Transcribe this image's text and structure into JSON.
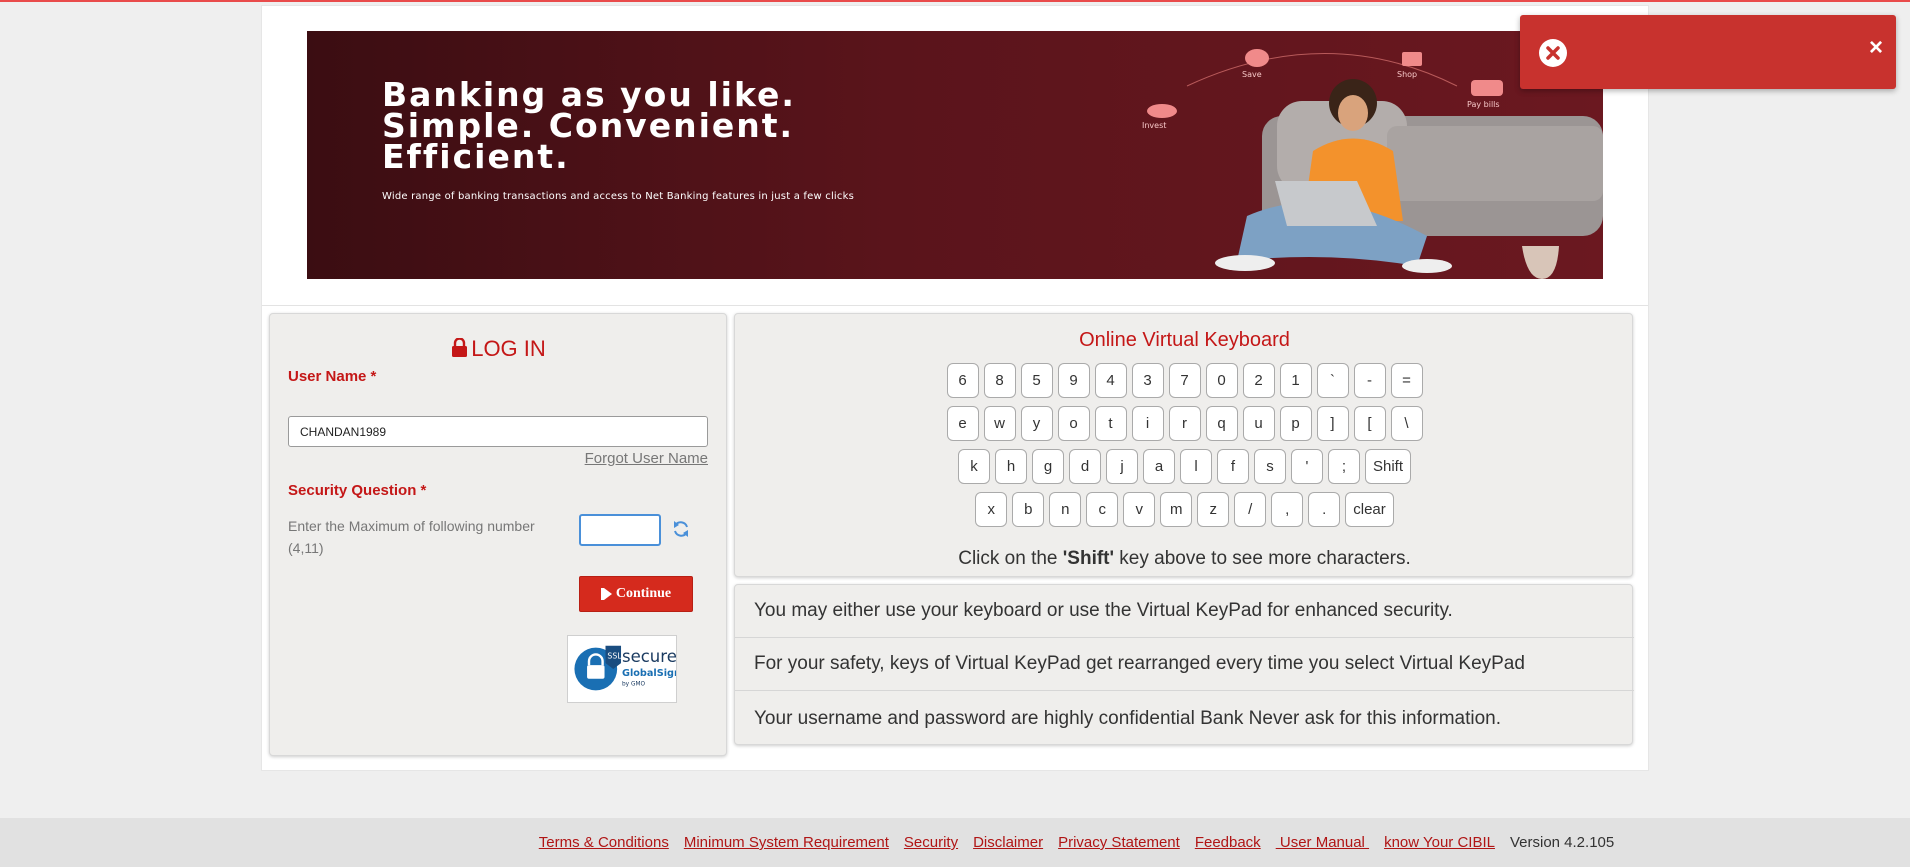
{
  "banner": {
    "headline": [
      "Banking as you like.",
      "Simple. Convenient.",
      "Efficient."
    ],
    "subtitle": "Wide range of banking transactions and access to Net Banking features in just a few clicks",
    "icons": [
      {
        "name": "invest-icon",
        "label": "Invest"
      },
      {
        "name": "save-icon",
        "label": "Save"
      },
      {
        "name": "shop-icon",
        "label": "Shop"
      },
      {
        "name": "pay-bills-icon",
        "label": "Pay bills"
      }
    ]
  },
  "login": {
    "title": "LOG IN",
    "username_label": "User Name *",
    "username_value": "CHANDAN1989",
    "forgot_username": "Forgot User Name",
    "security_label": "Security Question *",
    "security_question": "Enter the Maximum of following number (4,11)",
    "answer_value": "",
    "continue_label": "Continue",
    "badge": {
      "ssl": "SSL",
      "secure": "secure",
      "brand": "GlobalSign",
      "by": "by GMO"
    }
  },
  "keyboard": {
    "title": "Online Virtual Keyboard",
    "rows": [
      [
        "6",
        "8",
        "5",
        "9",
        "4",
        "3",
        "7",
        "0",
        "2",
        "1",
        "`",
        "-",
        "="
      ],
      [
        "e",
        "w",
        "y",
        "o",
        "t",
        "i",
        "r",
        "q",
        "u",
        "p",
        "]",
        "[",
        "\\"
      ],
      [
        "k",
        "h",
        "g",
        "d",
        "j",
        "a",
        "l",
        "f",
        "s",
        "'",
        ";",
        "Shift"
      ],
      [
        "x",
        "b",
        "n",
        "c",
        "v",
        "m",
        "z",
        "/",
        ",",
        ".",
        "clear"
      ]
    ],
    "note_prefix": "Click on the ",
    "note_key": "'Shift'",
    "note_suffix": " key above to see more characters."
  },
  "info": [
    "You may either use your keyboard or use the Virtual KeyPad for enhanced security.",
    "For your safety, keys of Virtual KeyPad get rearranged every time you select Virtual KeyPad",
    "Your username and password are highly confidential Bank Never ask for this information."
  ],
  "footer": {
    "links": [
      "Terms & Conditions",
      "Minimum System Requirement",
      "Security",
      "Disclaimer",
      "Privacy Statement",
      "Feedback",
      " User Manual ",
      "know Your CIBIL"
    ],
    "version": "Version 4.2.105"
  },
  "toast": {
    "close": "×"
  },
  "colors": {
    "brand_red": "#c41717",
    "button_red": "#d52a1d",
    "toast_red": "#c8322e",
    "banner_dark": "#4a1016"
  }
}
